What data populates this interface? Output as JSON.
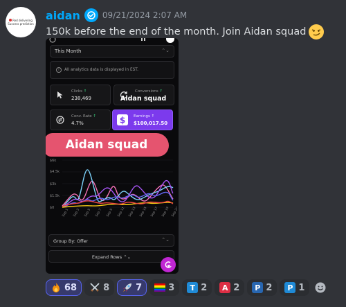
{
  "author": {
    "name": "aidan",
    "timestamp": "09/21/2024 2:07 AM",
    "avatar_text": "Red delivering Success prediction"
  },
  "message": {
    "text": "150k before the end of the month. Join Aidan squad"
  },
  "screenshot": {
    "period_label": "This Month",
    "notice": "All analytics data is displayed in EST.",
    "cards": {
      "clicks_label": "Clicks",
      "clicks_value": "238,469",
      "conversions_label": "Conversions",
      "conv_rate_label": "Conv. Rate",
      "conv_rate_value": "4.7%",
      "earnings_label": "Earnings",
      "earnings_value": "$100,017.50"
    },
    "overlay_small": "Aidan squad",
    "overlay_big": "Aidan squad",
    "chart": {
      "y_ticks": [
        "$6k",
        "$4.5k",
        "$3k",
        "$1.5k",
        "$0"
      ],
      "x_ticks": [
        "Sep 1",
        "Sep 3",
        "Sep 5",
        "Sep 7",
        "Sep 9",
        "Sep 11",
        "Sep 13",
        "Sep 15",
        "Sep 17",
        "Sep 19",
        "Sep 20"
      ]
    },
    "group_by": "Group By: Offer",
    "expand_rows": "Expand Rows"
  },
  "reactions": [
    {
      "icon": "fire-icon",
      "count": "68",
      "active": true
    },
    {
      "icon": "crossed-swords-icon",
      "count": "8",
      "active": false
    },
    {
      "icon": "rocket-icon",
      "count": "7",
      "active": true
    },
    {
      "icon": "rainbow-flag-icon",
      "count": "3",
      "active": false
    },
    {
      "icon": "letter-t-icon",
      "letter": "T",
      "color": "#1f8ad6",
      "count": "2",
      "active": false
    },
    {
      "icon": "letter-a-icon",
      "letter": "A",
      "color": "#dd2e44",
      "count": "2",
      "active": false
    },
    {
      "icon": "letter-p-icon",
      "letter": "P",
      "color": "#2866b0",
      "count": "2",
      "active": false
    },
    {
      "icon": "letter-p-icon",
      "letter": "P",
      "color": "#1f8ad6",
      "count": "1",
      "active": false
    }
  ],
  "colors": {
    "accent": "#00a8fc",
    "earnings_card": "#7c3aed",
    "overlay": "#e5546f"
  }
}
